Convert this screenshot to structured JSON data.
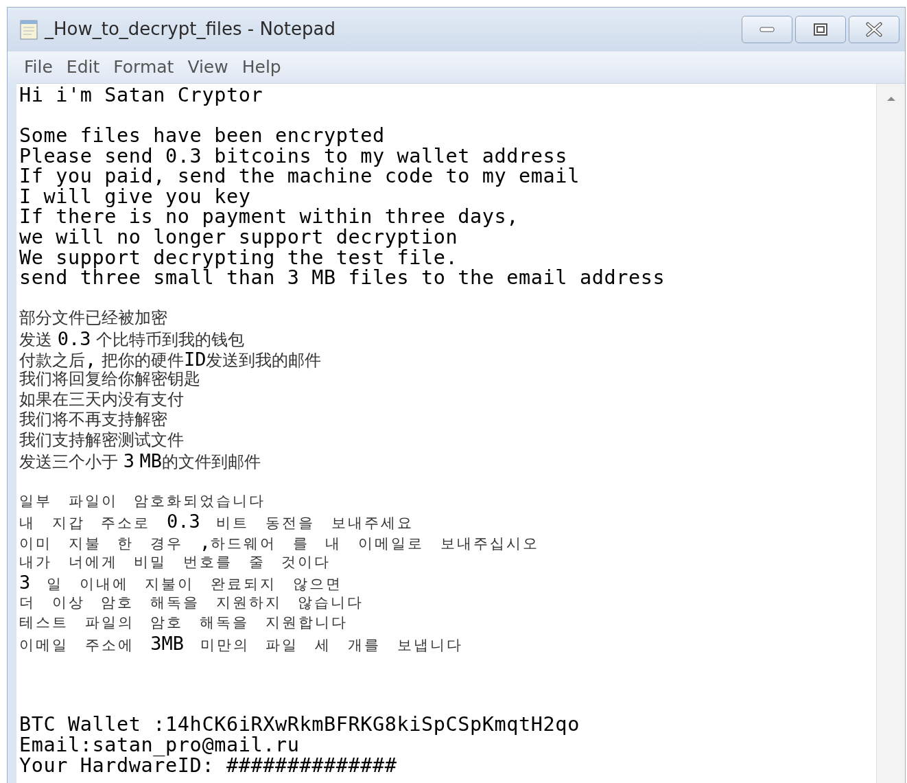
{
  "window": {
    "title": "_How_to_decrypt_files - Notepad"
  },
  "menu": [
    "File",
    "Edit",
    "Format",
    "View",
    "Help"
  ],
  "blocks": [
    {
      "kind": "latin",
      "lines": [
        "Hi i'm Satan Cryptor"
      ]
    },
    {
      "kind": "latin",
      "lines": [
        "Some files have been encrypted",
        "Please send 0.3 bitcoins to my wallet address",
        "If you paid, send the machine code to my email",
        "I will give you key",
        "If there is no payment within three days,",
        "we will no longer support decryption",
        "We support decrypting the test file.",
        "send three small than 3 MB files to the email address"
      ]
    },
    {
      "kind": "cjk",
      "lines": [
        "部分文件已经被加密",
        "发送 **0.3** 个比特币到我的钱包",
        "付款之后**,** 把你的硬件**ID**发送到我的邮件",
        "我们将回复给你解密钥匙",
        "如果在三天内没有支付",
        "我们将不再支持解密",
        "我们支持解密测试文件",
        "发送三个小于 **3** **MB**的文件到邮件"
      ]
    },
    {
      "kind": "korean",
      "lines": [
        "일부 파일이 암호화되었습니다",
        "내 지갑 주소로 **0.3** 비트 동전을 보내주세요",
        "이미 지불 한 경우 **,**하드웨어 를 내 이메일로 보내주십시오",
        "내가 너에게 비밀 번호를 줄 것이다",
        "**3** 일 이내에 지불이 완료되지 않으면",
        "더 이상 암호 해독을 지원하지 않습니다",
        "테스트 파일의 암호 해독을 지원합니다",
        "이메일 주소에 **3MB** 미만의 파일 세 개를 보냅니다"
      ]
    },
    {
      "kind": "footer",
      "lines": [
        "BTC Wallet :14hCK6iRXwRkmBFRKG8kiSpCSpKmqtH2qo",
        "Email:satan_pro@mail.ru",
        "Your HardwareID: ##############"
      ]
    }
  ]
}
